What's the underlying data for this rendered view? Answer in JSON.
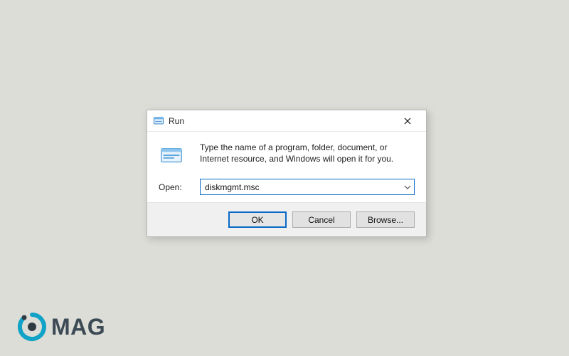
{
  "dialog": {
    "title": "Run",
    "description": "Type the name of a program, folder, document, or Internet resource, and Windows will open it for you.",
    "open_label": "Open:",
    "open_value": "diskmgmt.msc",
    "buttons": {
      "ok": "OK",
      "cancel": "Cancel",
      "browse": "Browse..."
    }
  },
  "watermark": {
    "text": "MAG"
  }
}
